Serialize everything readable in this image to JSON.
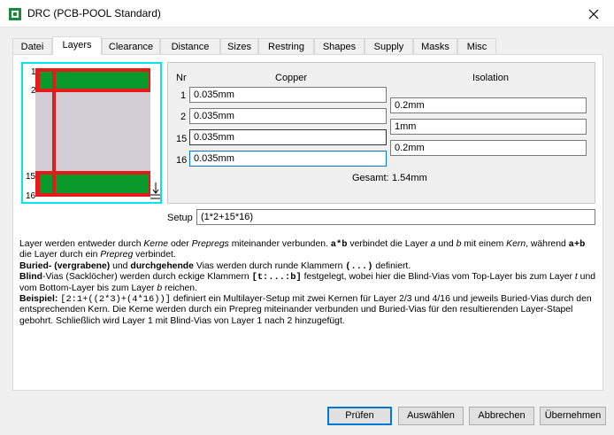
{
  "window": {
    "title": "DRC (PCB-POOL Standard)"
  },
  "tabs": [
    {
      "label": "Datei"
    },
    {
      "label": "Layers"
    },
    {
      "label": "Clearance"
    },
    {
      "label": "Distance"
    },
    {
      "label": "Sizes"
    },
    {
      "label": "Restring"
    },
    {
      "label": "Shapes"
    },
    {
      "label": "Supply"
    },
    {
      "label": "Masks"
    },
    {
      "label": "Misc"
    }
  ],
  "active_tab": "Layers",
  "stack_preview": {
    "labels": [
      "1",
      "2",
      "15",
      "16"
    ]
  },
  "layers": {
    "nr_header": "Nr",
    "copper_header": "Copper",
    "isolation_header": "Isolation",
    "rows": [
      {
        "nr": "1",
        "copper": "0.035mm"
      },
      {
        "nr": "2",
        "copper": "0.035mm"
      },
      {
        "nr": "15",
        "copper": "0.035mm"
      },
      {
        "nr": "16",
        "copper": "0.035mm"
      }
    ],
    "isolation": [
      "0.2mm",
      "1mm",
      "0.2mm"
    ],
    "gesamt_label": "Gesamt:",
    "gesamt_value": "1.54mm"
  },
  "setup": {
    "label": "Setup",
    "value": "(1*2+15*16)"
  },
  "help": {
    "p1a": "Layer werden entweder durch ",
    "p1_kerne": "Kerne",
    "p1b": " oder ",
    "p1_prepregs": "Prepregs",
    "p1c": " miteinander verbunden. ",
    "p1_ab": "a*b",
    "p1d": " verbindet die Layer ",
    "p1_a": "a",
    "p1e": " und ",
    "p1_b": "b",
    "p1f": " mit einem ",
    "p1_kern": "Kern",
    "p1g": ", während ",
    "p1_apb": "a+b",
    "p1h": " die Layer durch ein ",
    "p1_prepreg": "Prepreg",
    "p1i": " verbindet.",
    "p2_buried": "Buried",
    "p2_vergrabene": "- (vergrabene)",
    "p2a": " und ",
    "p2_durch": "durchgehende",
    "p2b": " Vias werden durch runde Klammern ",
    "p2_code": "(...)",
    "p2c": " definiert.",
    "p3_blind": "Blind",
    "p3a": "-Vias (Sacklöcher) werden durch eckige Klammern ",
    "p3_code": "[t:...:b]",
    "p3b": " festgelegt, wobei hier die Blind-Vias vom Top-Layer bis zum Layer ",
    "p3_t": "t",
    "p3c": " und vom Bottom-Layer bis zum Layer ",
    "p3_b": "b",
    "p3d": " reichen.",
    "p4_beispiel": "Beispiel:",
    "p4_code": "[2:1+((2*3)+(4*16))]",
    "p4a": " definiert ein Multilayer-Setup mit zwei Kernen für Layer 2/3 und 4/16 und jeweils Buried-Vias durch den entsprechenden Kern. Die Kerne werden durch ein Prepreg miteinander verbunden und Buried-Vias für den resultierenden Layer-Stapel gebohrt. Schließlich wird Layer 1 mit Blind-Vias von Layer 1 nach 2 hinzugefügt."
  },
  "buttons": {
    "pruefen": "Prüfen",
    "auswaehlen": "Auswählen",
    "abbrechen": "Abbrechen",
    "uebernehmen": "Übernehmen"
  },
  "colors": {
    "copper_green": "#0a9a2c",
    "via_red": "#e41b1b",
    "core_fill": "#d3cdd6",
    "frame_cyan": "#00e5ee",
    "focus_blue": "#0078d7"
  }
}
